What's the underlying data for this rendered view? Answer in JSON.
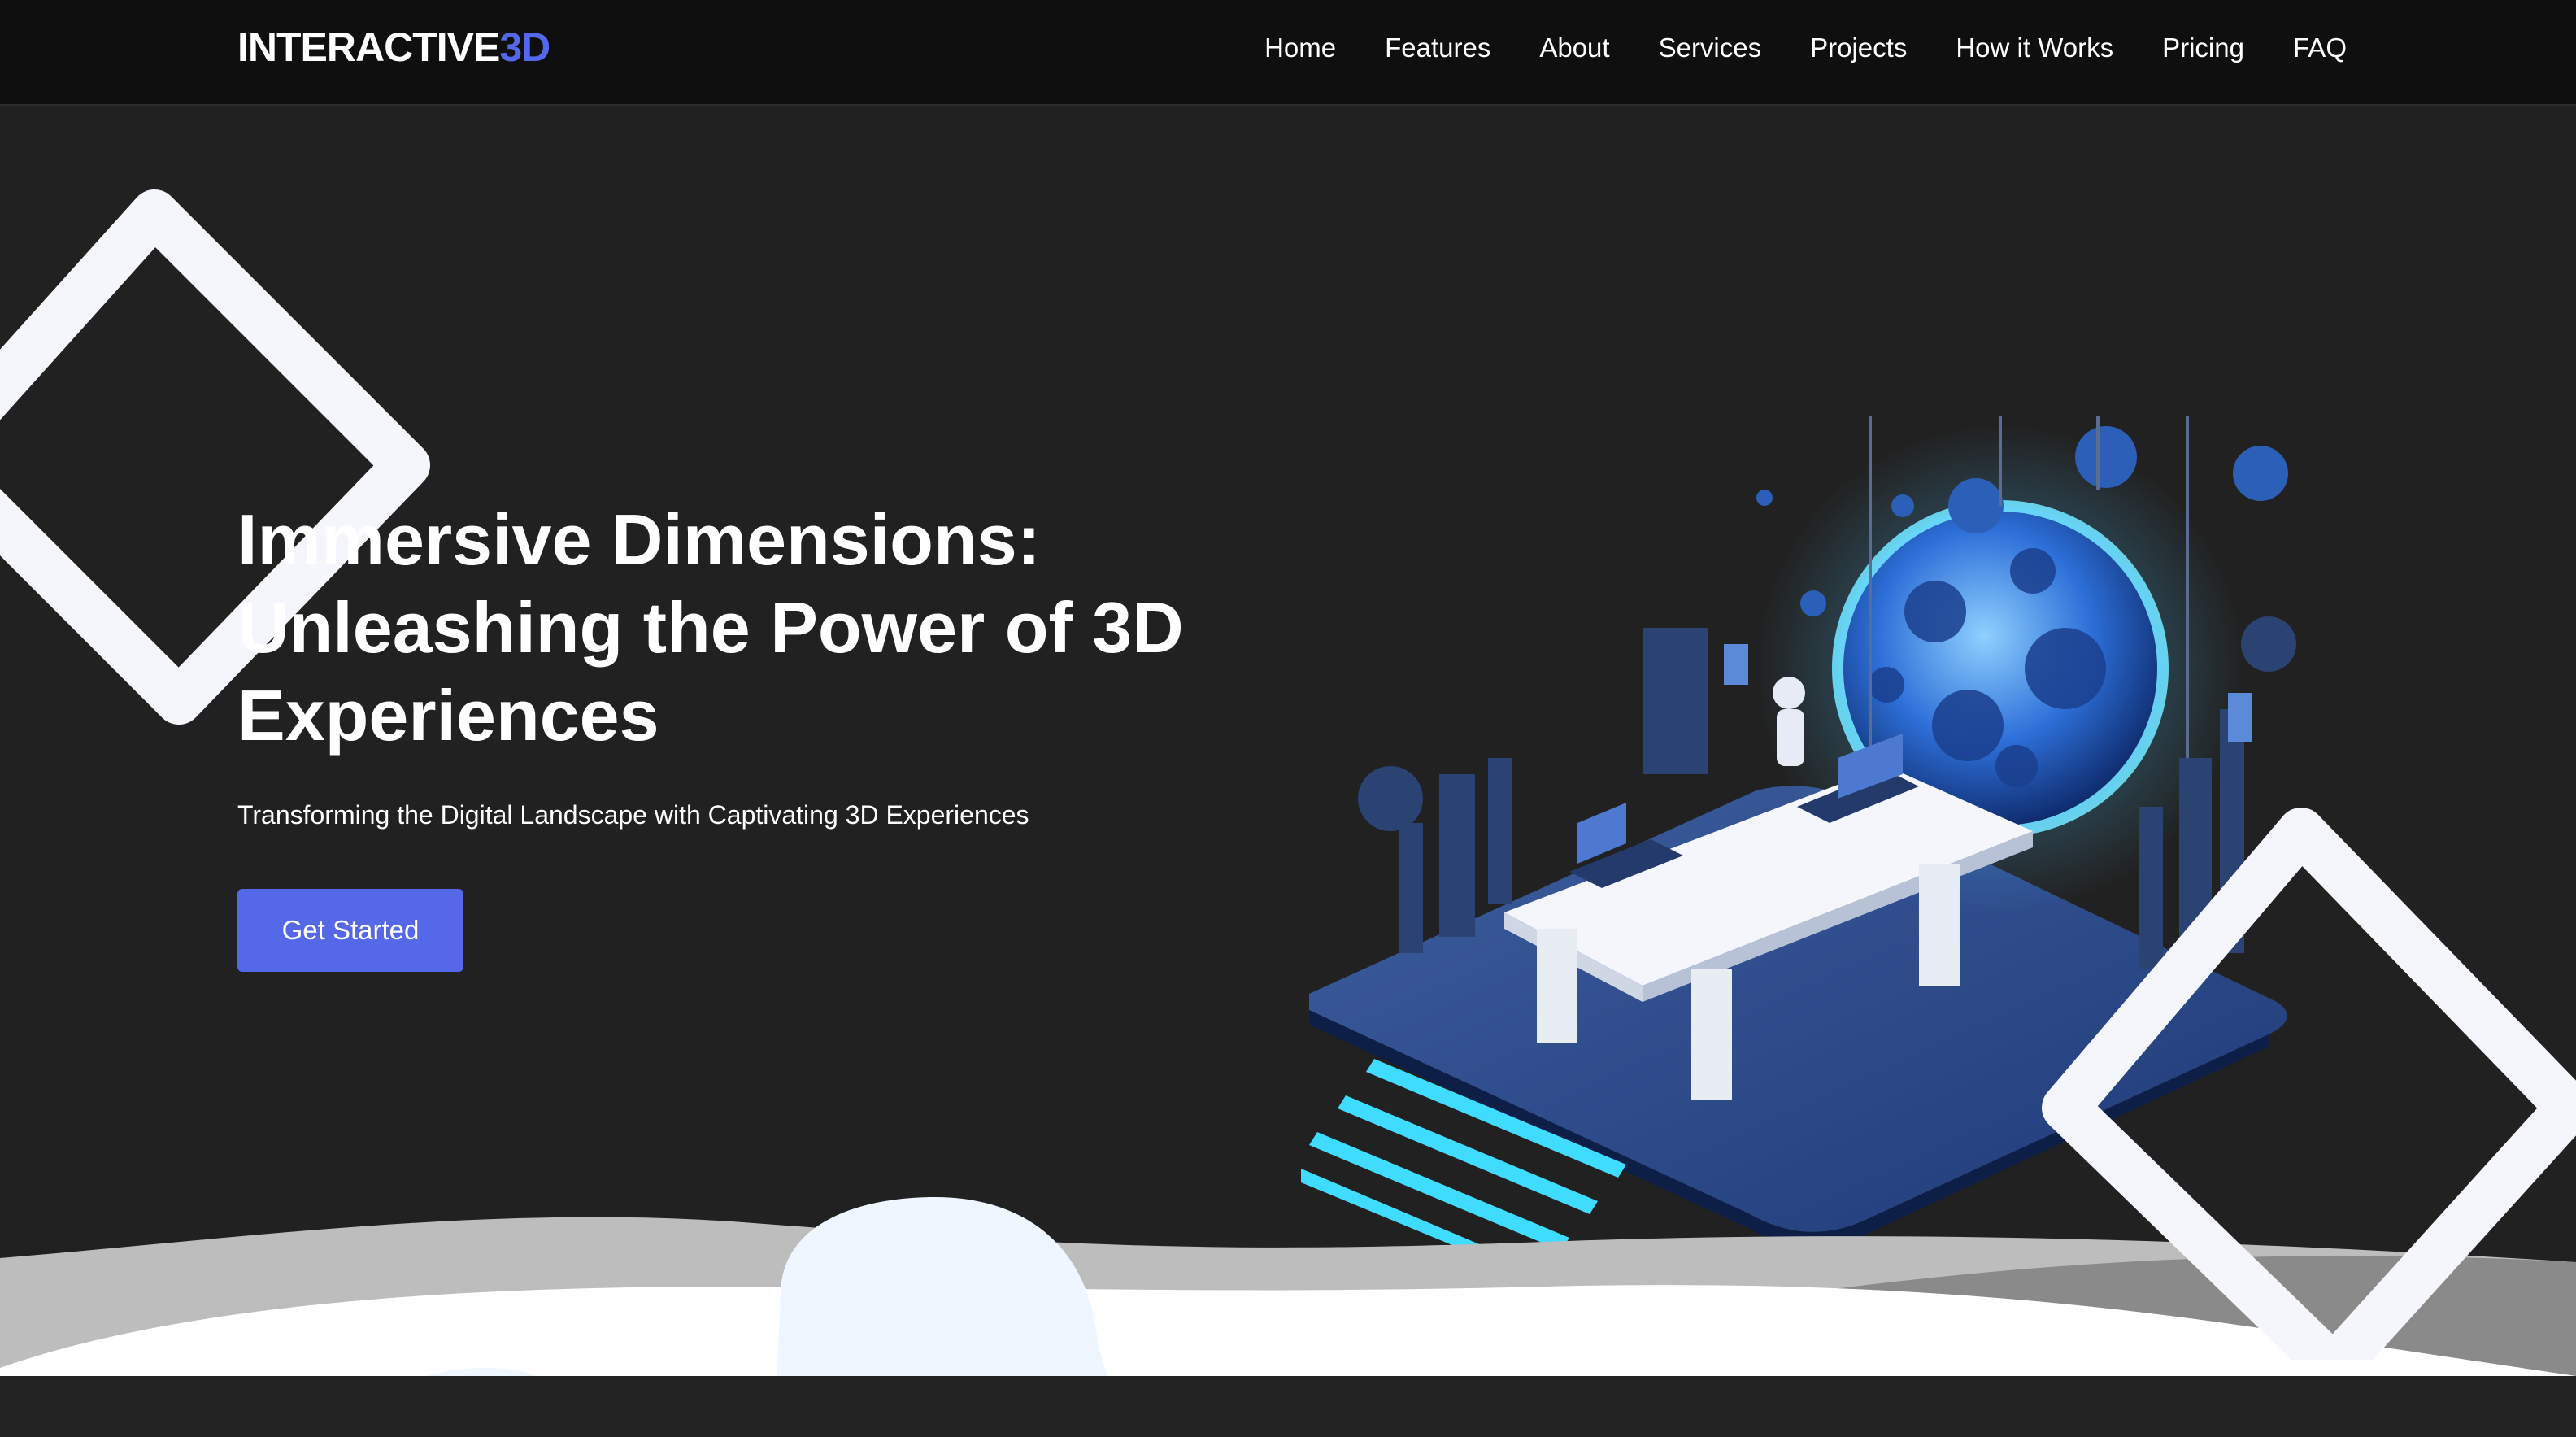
{
  "brand": {
    "name_main": "INTERACTIVE",
    "name_accent": "3D",
    "accent_color": "#5468ee"
  },
  "nav": {
    "items": [
      {
        "label": "Home"
      },
      {
        "label": "Features"
      },
      {
        "label": "About"
      },
      {
        "label": "Services"
      },
      {
        "label": "Projects"
      },
      {
        "label": "How it Works"
      },
      {
        "label": "Pricing"
      },
      {
        "label": "FAQ"
      }
    ]
  },
  "hero": {
    "title": "Immersive Dimensions: Unleashing the Power of 3D Experiences",
    "subtitle": "Transforming the Digital Landscape with Captivating 3D Experiences",
    "cta_label": "Get Started",
    "cta_color": "#5468e8",
    "background": "#212121"
  }
}
